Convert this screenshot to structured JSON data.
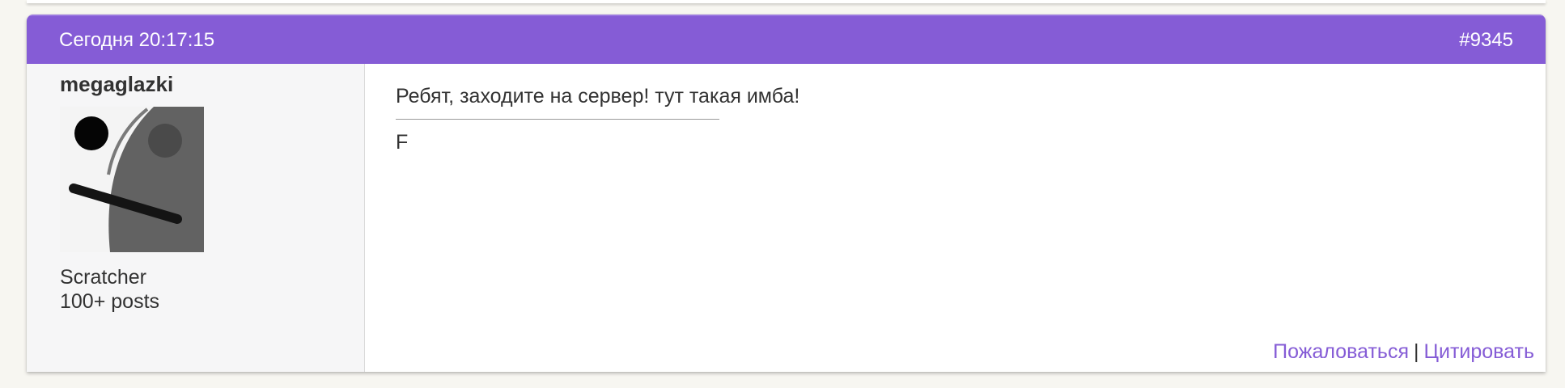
{
  "post": {
    "date": "Сегодня 20:17:15",
    "number": "#9345",
    "author": {
      "username": "megaglazki",
      "rank": "Scratcher",
      "post_count": "100+ posts"
    },
    "content": {
      "text": "Ребят, заходите на сервер! тут такая имба!",
      "signature": "F"
    },
    "actions": {
      "report": "Пожаловаться",
      "separator": "|",
      "quote": "Цитировать"
    }
  },
  "colors": {
    "header_bg": "#855cd6",
    "link": "#855cd6",
    "sidebar_bg": "#f6f6f7",
    "page_bg": "#f7f6f1"
  },
  "icons": {
    "avatar": "user-avatar-image"
  }
}
